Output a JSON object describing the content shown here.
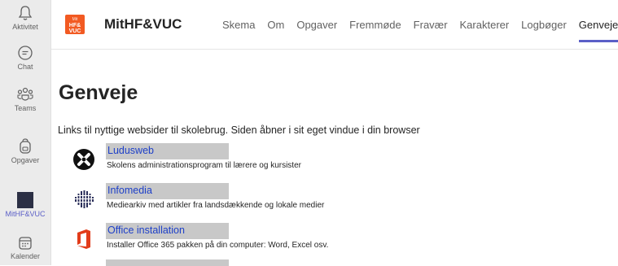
{
  "rail": {
    "items": [
      {
        "label": "Aktivitet",
        "icon": "bell-icon"
      },
      {
        "label": "Chat",
        "icon": "chat-icon"
      },
      {
        "label": "Teams",
        "icon": "teams-icon"
      },
      {
        "label": "Opgaver",
        "icon": "backpack-icon"
      },
      {
        "label": "MitHF&VUC",
        "icon": "app-tile-icon"
      },
      {
        "label": "Kalender",
        "icon": "calendar-icon"
      }
    ],
    "active_color": "#5b5fc7"
  },
  "header": {
    "logo_small": "Mit",
    "logo_line1": "HF&",
    "logo_line2": "VUC",
    "app_name": "MitHF&VUC",
    "tabs": [
      "Skema",
      "Om",
      "Opgaver",
      "Fremmøde",
      "Fravær",
      "Karakterer",
      "Logbøger",
      "Genveje"
    ],
    "active_tab": "Genveje",
    "brand_color": "#f25a22"
  },
  "main": {
    "title": "Genveje",
    "intro": "Links til nyttige websider til skolebrug. Siden åbner i sit eget vindue i din browser",
    "links": [
      {
        "name": "Ludusweb",
        "description": "Skolens administrationsprogram til lærere og kursister",
        "icon": "ludus-icon"
      },
      {
        "name": "Infomedia",
        "description": "Mediearkiv med artikler fra landsdækkende og lokale medier",
        "icon": "infomedia-icon"
      },
      {
        "name": "Office installation",
        "description": "Installer Office 365 pakken på din computer: Word, Excel osv.",
        "icon": "office-icon"
      }
    ],
    "link_color": "#1e40c8"
  }
}
